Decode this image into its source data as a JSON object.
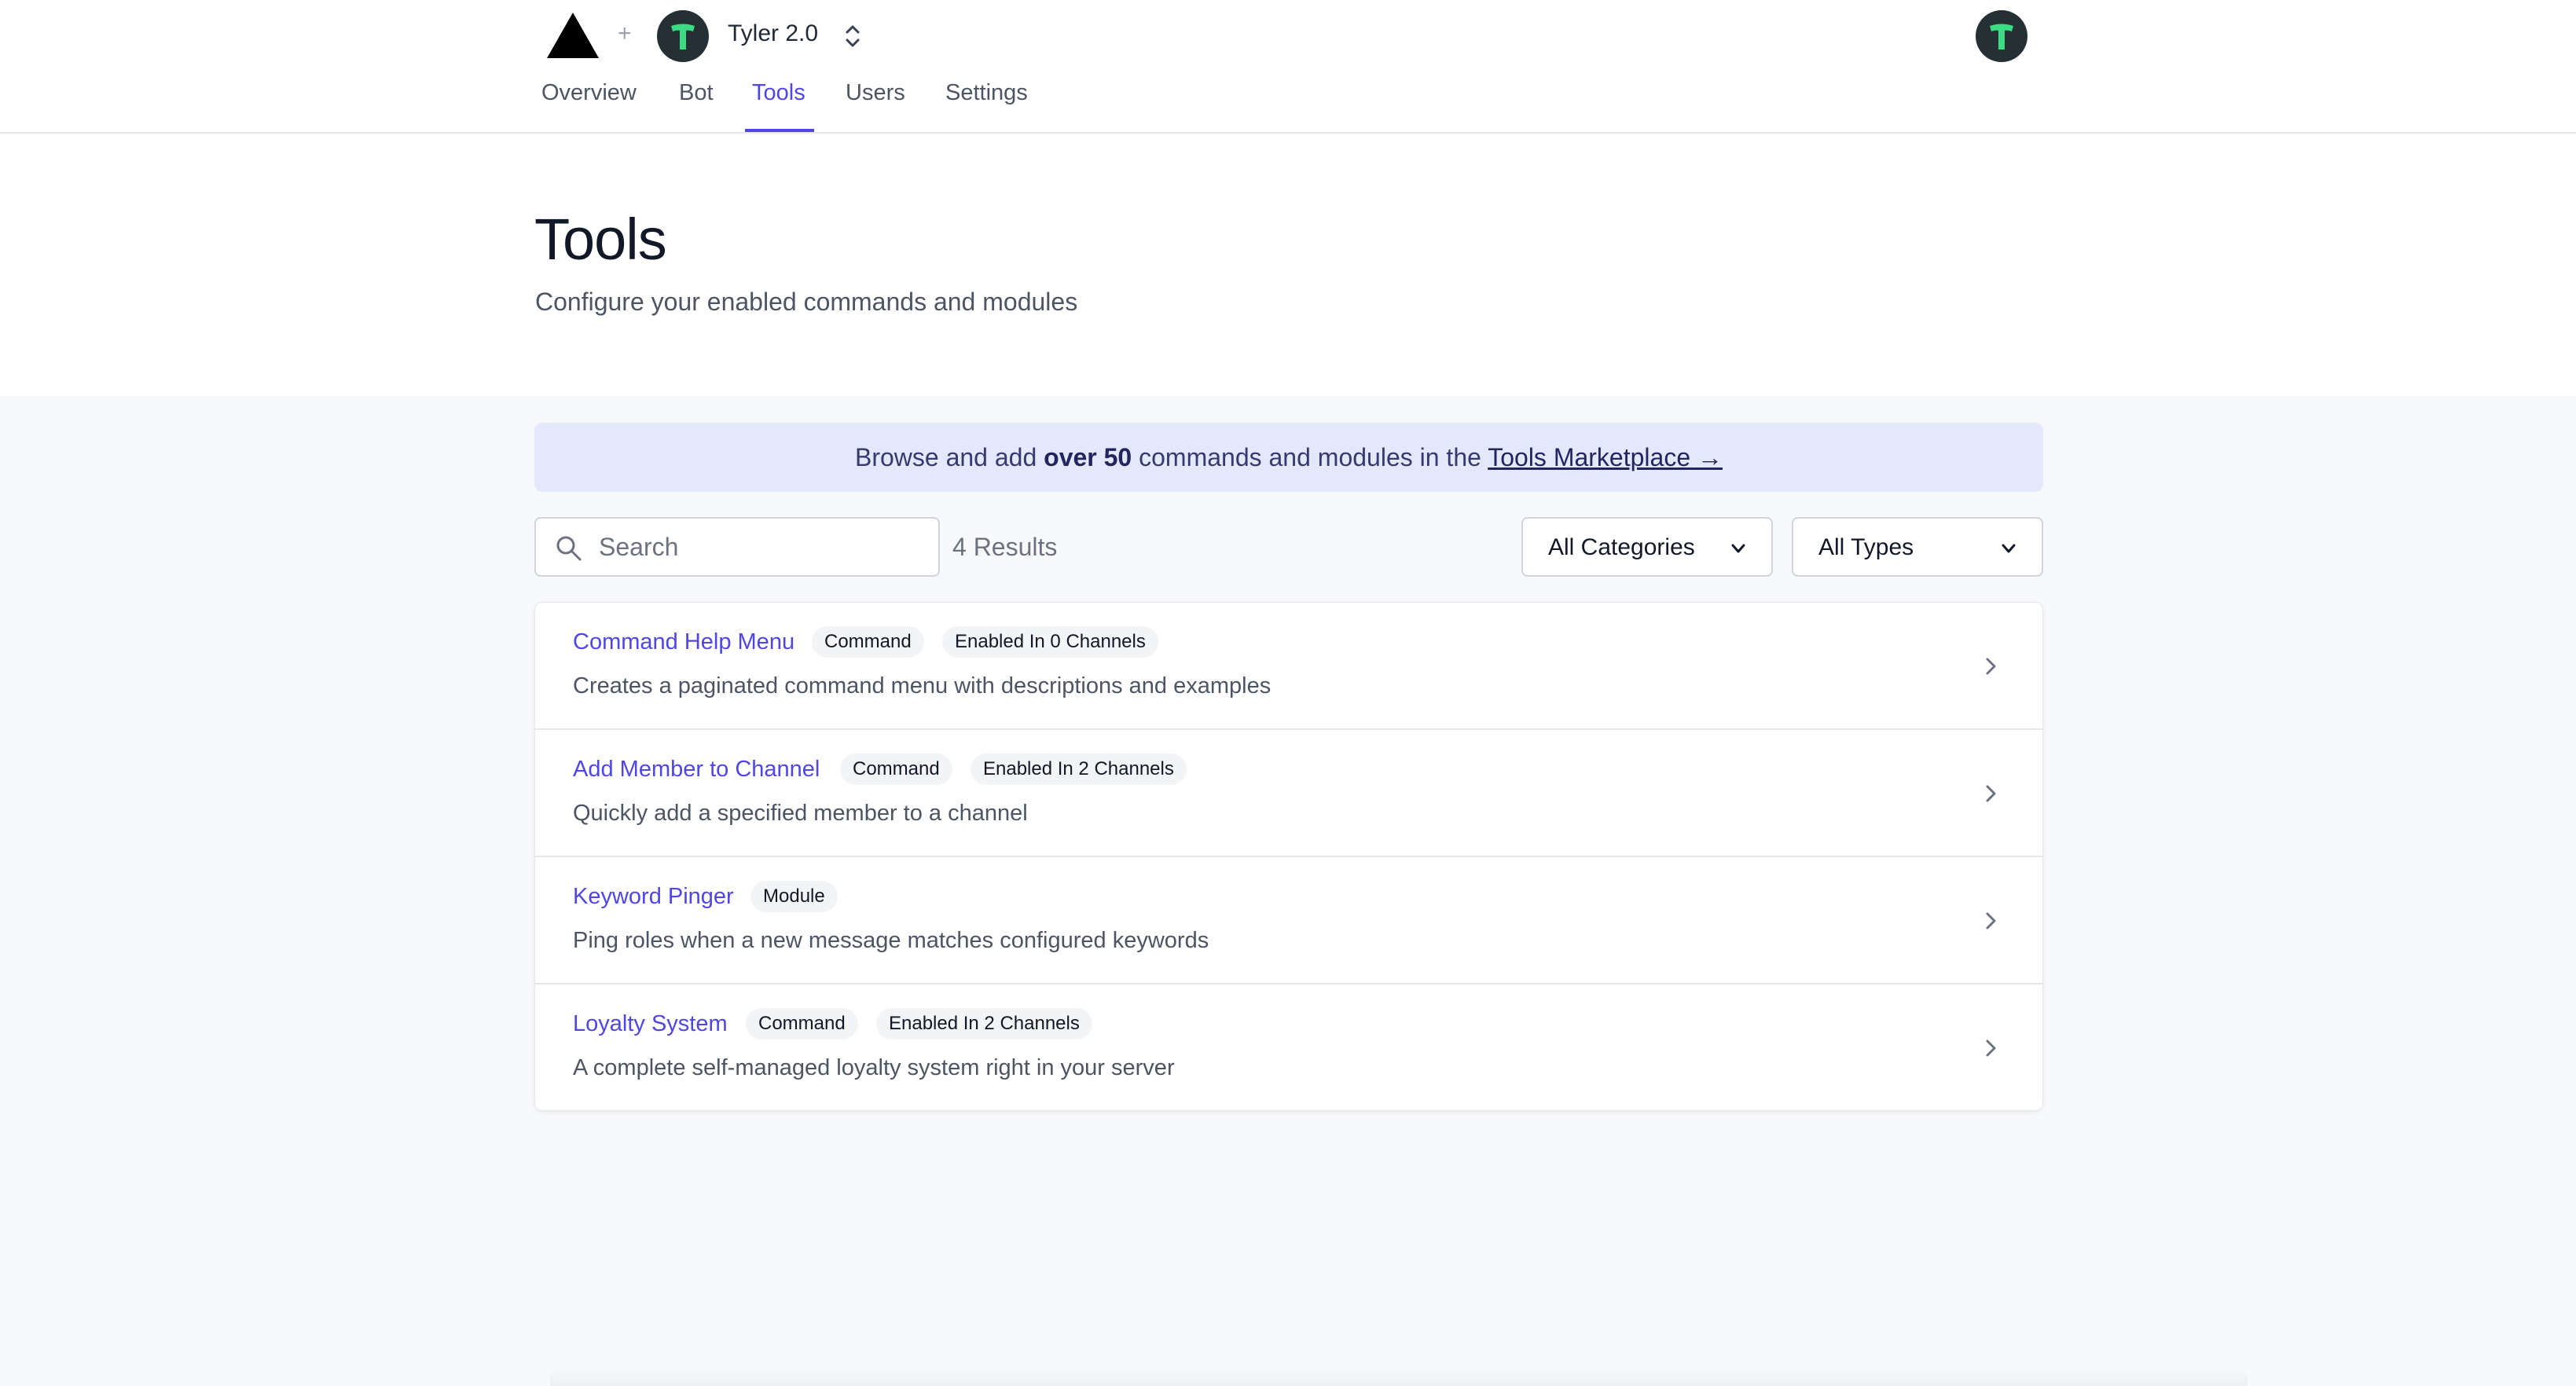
{
  "header": {
    "icons": {
      "logo": "triangle-logo-icon",
      "plus": "plus-icon",
      "switcher": "chevron-up-down-icon",
      "bot_avatar": "bot-avatar-t-icon",
      "user_avatar": "user-avatar-t-icon"
    },
    "plus_symbol": "+",
    "bot_name": "Tyler 2.0",
    "nav_tabs": [
      {
        "label": "Overview",
        "active": false
      },
      {
        "label": "Bot",
        "active": false
      },
      {
        "label": "Tools",
        "active": true
      },
      {
        "label": "Users",
        "active": false
      },
      {
        "label": "Settings",
        "active": false
      }
    ],
    "colors": {
      "accent": "#4f46e5",
      "avatar_bg": "#243034",
      "avatar_t": "#3ddc84"
    }
  },
  "page": {
    "title": "Tools",
    "subtitle": "Configure your enabled commands and modules"
  },
  "banner": {
    "prefix": "Browse and add ",
    "bold": "over 50",
    "middle": " commands and modules in the ",
    "link": "Tools Marketplace →",
    "bg_color": "#e3e8fa"
  },
  "filters": {
    "search_placeholder": "Search",
    "search_value": "",
    "search_icon": "search-icon",
    "results": "4 Results",
    "category_select": "All Categories",
    "type_select": "All Types",
    "dropdown_icon": "chevron-down-icon"
  },
  "tools": [
    {
      "name": "Command Help Menu",
      "type": "Command",
      "channels": "Enabled In 0 Channels",
      "description": "Creates a paginated command menu with descriptions and examples"
    },
    {
      "name": "Add Member to Channel",
      "type": "Command",
      "channels": "Enabled In 2 Channels",
      "description": "Quickly add a specified member to a channel"
    },
    {
      "name": "Keyword Pinger",
      "type": "Module",
      "channels": "",
      "description": "Ping roles when a new message matches configured keywords"
    },
    {
      "name": "Loyalty System",
      "type": "Command",
      "channels": "Enabled In 2 Channels",
      "description": "A complete self-managed loyalty system right in your server"
    }
  ],
  "row_icon": "chevron-right-icon"
}
